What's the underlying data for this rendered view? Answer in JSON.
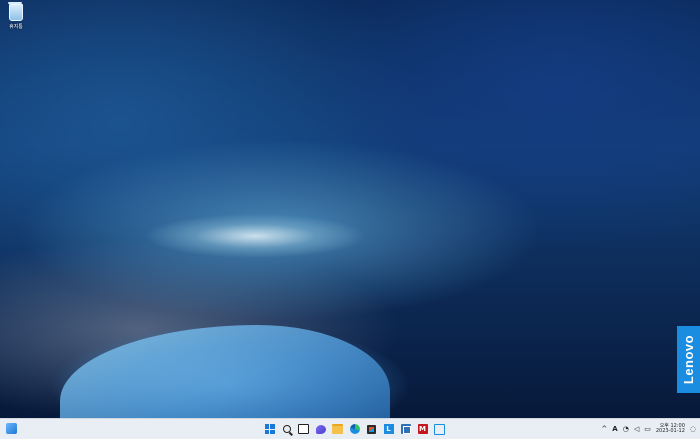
{
  "desktop": {
    "icons": [
      {
        "label": "휴지통",
        "icon": "recycle-bin-icon"
      }
    ],
    "brand_text": "Lenovo"
  },
  "taskbar": {
    "left": {
      "icon": "weather-widget-icon"
    },
    "pinned": [
      {
        "name": "start",
        "icon": "windows-start-icon"
      },
      {
        "name": "search",
        "icon": "search-icon"
      },
      {
        "name": "task-view",
        "icon": "task-view-icon"
      },
      {
        "name": "chat",
        "icon": "chat-icon"
      },
      {
        "name": "file-explorer",
        "icon": "folder-icon"
      },
      {
        "name": "edge",
        "icon": "edge-icon"
      },
      {
        "name": "store",
        "icon": "store-icon"
      },
      {
        "name": "lenovo",
        "icon": "lenovo-icon",
        "text": "L"
      },
      {
        "name": "vantage",
        "icon": "vantage-icon"
      },
      {
        "name": "mcafee",
        "icon": "mcafee-icon",
        "text": "M"
      },
      {
        "name": "app",
        "icon": "app-icon"
      }
    ],
    "tray": {
      "chevron": "^",
      "ime": "A",
      "wifi_icon": "wifi-icon",
      "volume_icon": "speaker-icon",
      "battery_icon": "battery-icon",
      "time": "오후 12:00",
      "date": "2023-01-12",
      "notification_icon": "notification-bell-icon"
    }
  }
}
